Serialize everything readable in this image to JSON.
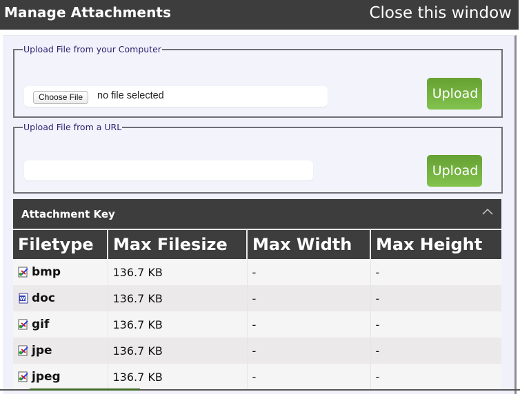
{
  "window": {
    "title": "Manage Attachments",
    "close_label": "Close this window"
  },
  "upload_computer": {
    "legend": "Upload File from your Computer",
    "choose_button": "Choose File",
    "file_status": "no file selected",
    "upload_button": "Upload"
  },
  "upload_url": {
    "legend": "Upload File from a URL",
    "url_value": "",
    "upload_button": "Upload"
  },
  "attachment_key": {
    "title": "Attachment Key",
    "collapse_icon": "chevron-up-icon",
    "columns": [
      "Filetype",
      "Max Filesize",
      "Max Width",
      "Max Height"
    ],
    "rows": [
      {
        "icon": "image-file-icon",
        "filetype": "bmp",
        "max_filesize": "136.7 KB",
        "max_width": "-",
        "max_height": "-"
      },
      {
        "icon": "word-doc-icon",
        "filetype": "doc",
        "max_filesize": "136.7 KB",
        "max_width": "-",
        "max_height": "-"
      },
      {
        "icon": "image-file-icon",
        "filetype": "gif",
        "max_filesize": "136.7 KB",
        "max_width": "-",
        "max_height": "-"
      },
      {
        "icon": "image-file-icon",
        "filetype": "jpe",
        "max_filesize": "136.7 KB",
        "max_width": "-",
        "max_height": "-"
      },
      {
        "icon": "image-file-icon",
        "filetype": "jpeg",
        "max_filesize": "136.7 KB",
        "max_width": "-",
        "max_height": "-"
      }
    ]
  },
  "colors": {
    "header_bg": "#3d3d3d",
    "panel_bg": "#f1f1fb",
    "upload_green": "#72b13f",
    "legend_text": "#2a1f6e"
  }
}
